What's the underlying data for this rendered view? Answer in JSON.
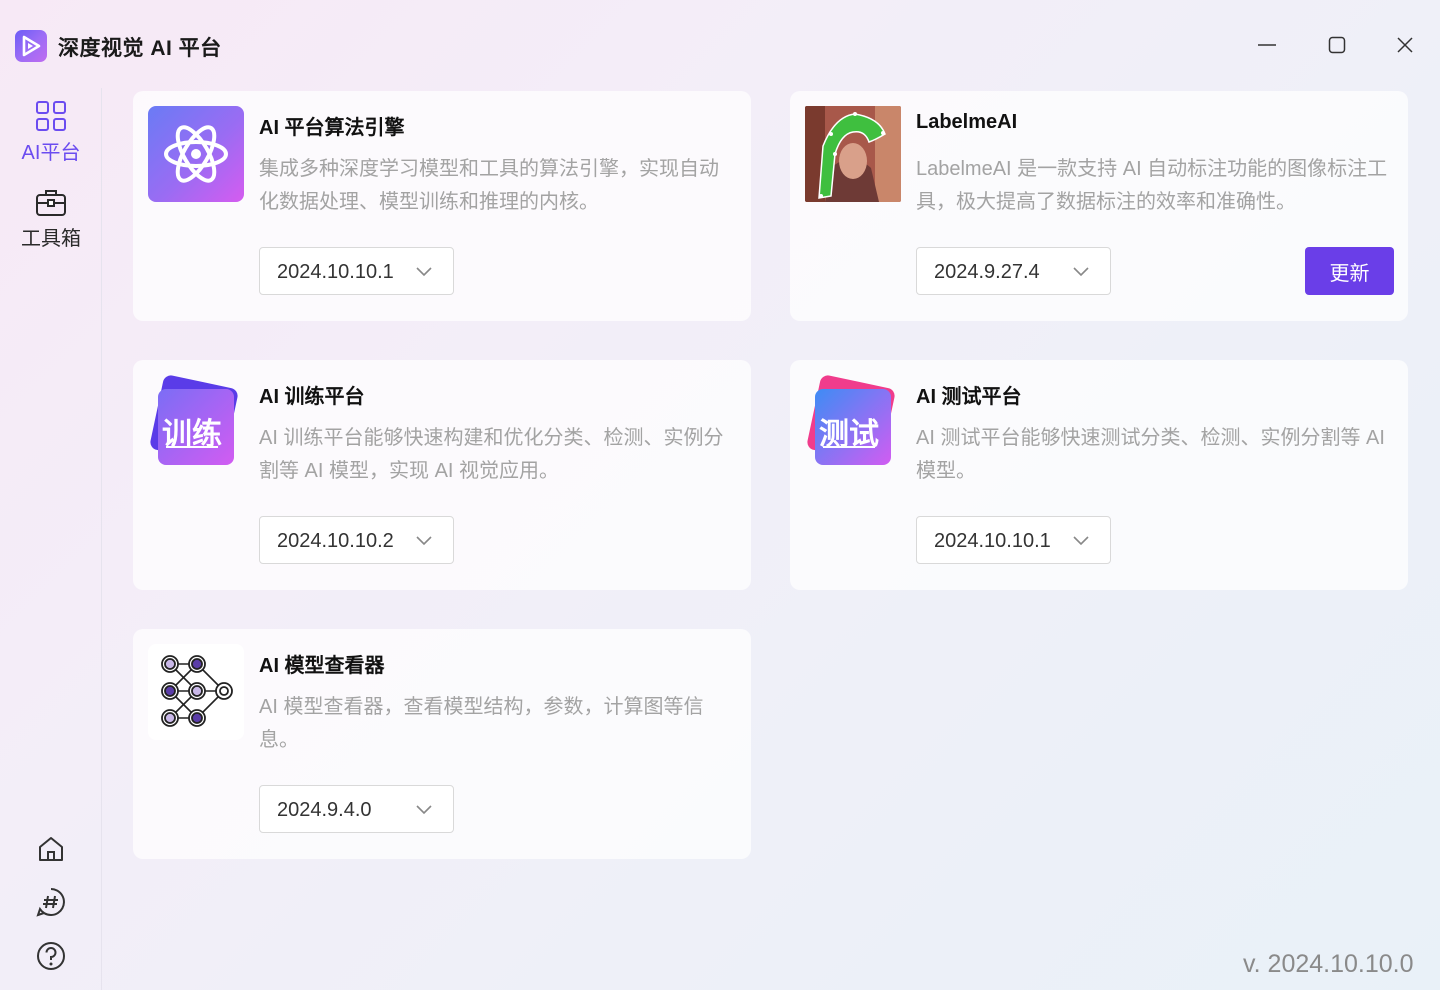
{
  "app": {
    "title": "深度视觉 AI 平台",
    "logo_icon": "play-logo-icon"
  },
  "window_controls": {
    "minimize_icon": "minimize-icon",
    "maximize_icon": "maximize-icon",
    "close_icon": "close-icon"
  },
  "sidebar": {
    "items": [
      {
        "label": "AI平台",
        "icon": "grid-icon",
        "active": true
      },
      {
        "label": "工具箱",
        "icon": "toolbox-icon",
        "active": false
      }
    ],
    "bottom_icons": [
      "home-icon",
      "hashtag-chat-icon",
      "help-icon"
    ]
  },
  "cards": [
    {
      "title": "AI 平台算法引擎",
      "description": "集成多种深度学习模型和工具的算法引擎，实现自动化数据处理、模型训练和推理的内核。",
      "version": "2024.10.10.1",
      "icon": "atom-icon"
    },
    {
      "title": "LabelmeAI",
      "description": "LabelmeAI 是一款支持 AI 自动标注功能的图像标注工具，极大提高了数据标注的效率和准确性。",
      "version": "2024.9.27.4",
      "icon": "labelme-image-icon",
      "action_label": "更新"
    },
    {
      "title": "AI 训练平台",
      "description": "AI 训练平台能够快速构建和优化分类、检测、实例分割等 AI 模型，实现 AI 视觉应用。",
      "version": "2024.10.10.2",
      "icon": "training-icon",
      "icon_text": "训练"
    },
    {
      "title": "AI 测试平台",
      "description": "AI 测试平台能够快速测试分类、检测、实例分割等 AI 模型。",
      "version": "2024.10.10.1",
      "icon": "testing-icon",
      "icon_text": "测试"
    },
    {
      "title": "AI 模型查看器",
      "description": "AI 模型查看器，查看模型结构，参数，计算图等信息。",
      "version": "2024.9.4.0",
      "icon": "network-graph-icon"
    }
  ],
  "footer": {
    "version": "v. 2024.10.10.0"
  },
  "colors": {
    "accent": "#6a3ee8",
    "active_nav": "#6b4cf0"
  }
}
